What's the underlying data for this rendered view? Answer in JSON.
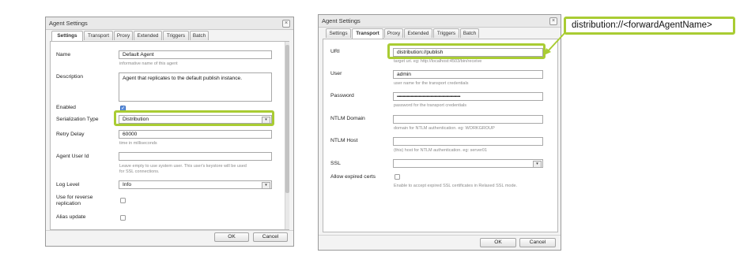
{
  "colors": {
    "highlight": "#a9cc33",
    "checkbox_checked": "#5b8fdc"
  },
  "left": {
    "title": "Agent Settings",
    "close_glyph": "×",
    "tabs": [
      {
        "label": "Settings",
        "active": true
      },
      {
        "label": "Transport"
      },
      {
        "label": "Proxy"
      },
      {
        "label": "Extended"
      },
      {
        "label": "Triggers"
      },
      {
        "label": "Batch"
      }
    ],
    "name": {
      "label": "Name",
      "value": "Default Agent",
      "hint": "informative name of this agent"
    },
    "description": {
      "label": "Description",
      "value": "Agent that replicates to the default publish instance."
    },
    "enabled": {
      "label": "Enabled",
      "checked": true
    },
    "serialization": {
      "label": "Serialization Type",
      "value": "Distribution"
    },
    "retry": {
      "label": "Retry Delay",
      "value": "60000",
      "hint": "time in milliseconds"
    },
    "userid": {
      "label": "Agent User Id",
      "value": "",
      "hint1": "Leave empty to use system user. This user's keystore will be used",
      "hint2": "for SSL connections."
    },
    "loglevel": {
      "label": "Log Level",
      "value": "Info"
    },
    "reverse": {
      "label1": "Use for reverse",
      "label2": "replication",
      "checked": false
    },
    "alias": {
      "label": "Alias update",
      "checked": false
    },
    "ok_label": "OK",
    "cancel_label": "Cancel",
    "arrow_glyph": "▾"
  },
  "right": {
    "title": "Agent Settings",
    "close_glyph": "×",
    "tabs": [
      {
        "label": "Settings"
      },
      {
        "label": "Transport",
        "active": true
      },
      {
        "label": "Proxy"
      },
      {
        "label": "Extended"
      },
      {
        "label": "Triggers"
      },
      {
        "label": "Batch"
      }
    ],
    "uri": {
      "label": "URI",
      "value": "distribution://publish",
      "hint": "target uri. eg: http://localhost:4503/bin/receive"
    },
    "user": {
      "label": "User",
      "value": "admin",
      "hint": "user name for the transport credentials"
    },
    "password": {
      "label": "Password",
      "value": "••••••••••••••••••••••••••••••••••••••••••••••••••••••••••••••••",
      "hint": "password for the transport credentials"
    },
    "ntlm_domain": {
      "label": "NTLM Domain",
      "value": "",
      "hint": "domain for NTLM authentication. eg: WORKGROUP"
    },
    "ntlm_host": {
      "label": "NTLM Host",
      "value": "",
      "hint": "(this) host for NTLM authentication. eg: server01"
    },
    "ssl": {
      "label": "SSL",
      "value": ""
    },
    "expired": {
      "label": "Allow expired certs",
      "checked": false,
      "hint": "Enable to accept expired SSL certificates in Relaxed SSL mode."
    },
    "ok_label": "OK",
    "cancel_label": "Cancel",
    "arrow_glyph": "▾"
  },
  "callout": {
    "text": "distribution://<forwardAgentName>"
  }
}
